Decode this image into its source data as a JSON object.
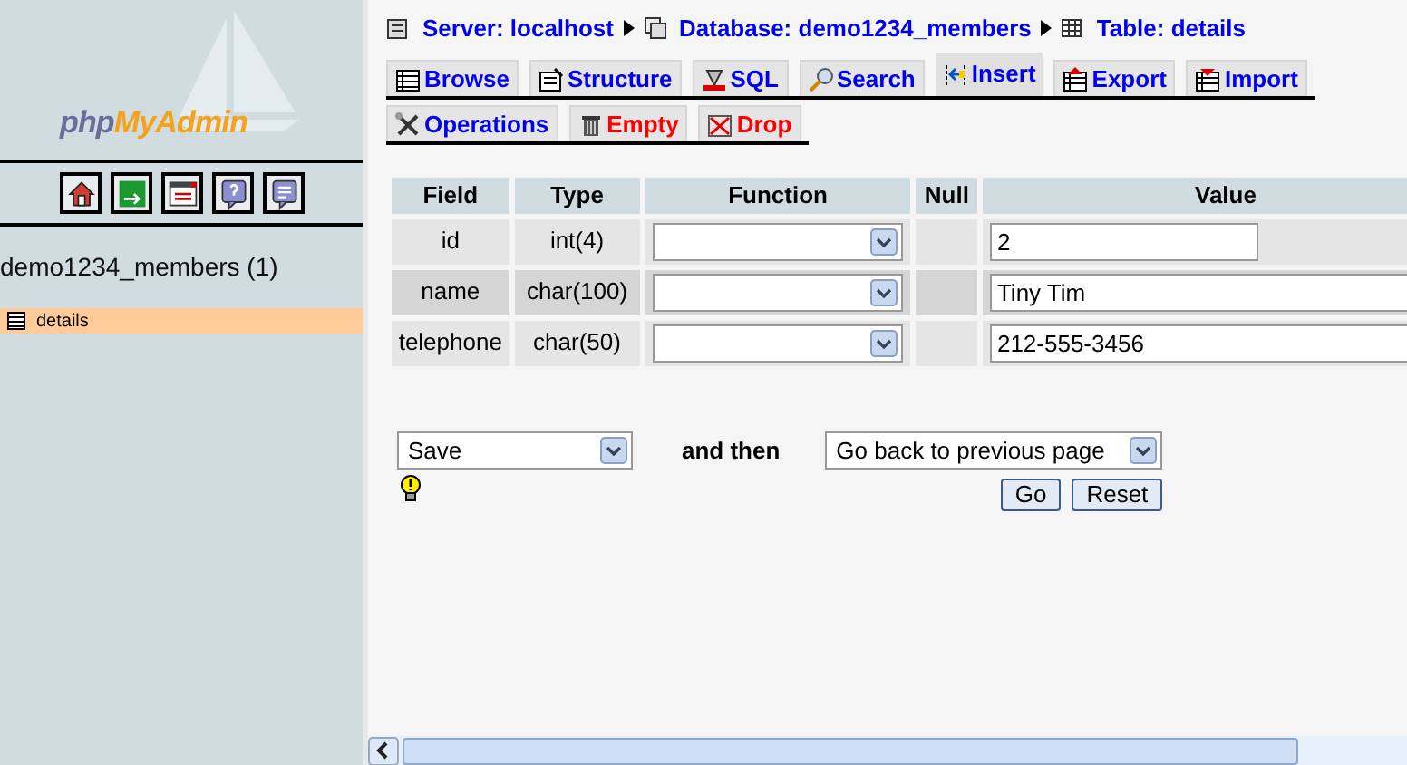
{
  "sidebar": {
    "logo": {
      "prefix": "php",
      "name": "MyAdmin"
    },
    "buttons": [
      {
        "kind": "home"
      },
      {
        "kind": "exit"
      },
      {
        "kind": "sqlwin"
      },
      {
        "kind": "help"
      },
      {
        "kind": "sqlquery"
      }
    ],
    "database": "demo1234_members (1)",
    "tables": [
      {
        "label": "details",
        "selected": true
      }
    ]
  },
  "breadcrumb": [
    {
      "kind": "server",
      "label": "Server: localhost"
    },
    {
      "kind": "database",
      "label": "Database: demo1234_members"
    },
    {
      "kind": "table",
      "label": "Table: details"
    }
  ],
  "tabs": [
    [
      {
        "kind": "browse",
        "label": "Browse",
        "selected": false,
        "danger": false
      },
      {
        "kind": "structure",
        "label": "Structure",
        "selected": false,
        "danger": false
      },
      {
        "kind": "sql",
        "label": "SQL",
        "selected": false,
        "danger": false
      },
      {
        "kind": "search",
        "label": "Search",
        "selected": false,
        "danger": false
      },
      {
        "kind": "insert",
        "label": "Insert",
        "selected": true,
        "danger": false
      },
      {
        "kind": "export",
        "label": "Export",
        "selected": false,
        "danger": false
      },
      {
        "kind": "import",
        "label": "Import",
        "selected": false,
        "danger": false
      }
    ],
    [
      {
        "kind": "operations",
        "label": "Operations",
        "selected": false,
        "danger": false
      },
      {
        "kind": "empty",
        "label": "Empty",
        "selected": false,
        "danger": true
      },
      {
        "kind": "drop",
        "label": "Drop",
        "selected": false,
        "danger": true
      }
    ]
  ],
  "table": {
    "columns": [
      "Field",
      "Type",
      "Function",
      "Null",
      "Value"
    ],
    "rows": [
      {
        "field": "id",
        "type": "int(4)",
        "value": "2",
        "wide": false,
        "highlighted": false
      },
      {
        "field": "name",
        "type": "char(100)",
        "value": "Tiny Tim",
        "wide": true,
        "highlighted": true
      },
      {
        "field": "telephone",
        "type": "char(50)",
        "value": "212-555-3456",
        "wide": true,
        "highlighted": false
      }
    ]
  },
  "action": {
    "value": "Save",
    "connector": "and then",
    "after": "Go back to previous page"
  },
  "buttons": [
    "Go",
    "Reset"
  ]
}
